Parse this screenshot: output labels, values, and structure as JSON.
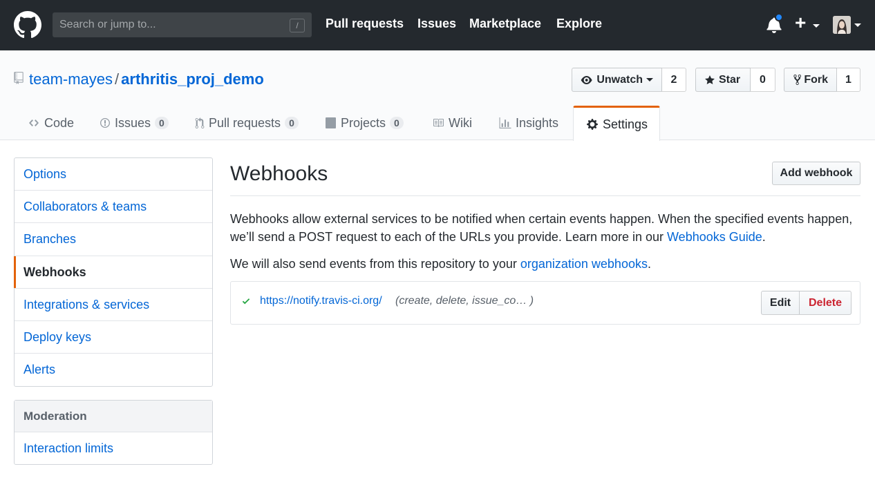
{
  "header": {
    "search_placeholder": "Search or jump to...",
    "search_shortcut": "/",
    "nav": [
      "Pull requests",
      "Issues",
      "Marketplace",
      "Explore"
    ],
    "plus_label": "+"
  },
  "repo": {
    "owner": "team-mayes",
    "separator": "/",
    "name": "arthritis_proj_demo",
    "unwatch_label": "Unwatch",
    "watch_count": "2",
    "star_label": "Star",
    "star_count": "0",
    "fork_label": "Fork",
    "fork_count": "1"
  },
  "tabs": [
    {
      "label": "Code",
      "icon": "code-icon"
    },
    {
      "label": "Issues",
      "icon": "issue-icon",
      "count": "0"
    },
    {
      "label": "Pull requests",
      "icon": "pull-request-icon",
      "count": "0"
    },
    {
      "label": "Projects",
      "icon": "project-icon",
      "count": "0"
    },
    {
      "label": "Wiki",
      "icon": "book-icon"
    },
    {
      "label": "Insights",
      "icon": "graph-icon"
    },
    {
      "label": "Settings",
      "icon": "gear-icon",
      "selected": true
    }
  ],
  "sidebar": {
    "items": [
      "Options",
      "Collaborators & teams",
      "Branches",
      "Webhooks",
      "Integrations & services",
      "Deploy keys",
      "Alerts"
    ],
    "selected": "Webhooks",
    "moderation_heading": "Moderation",
    "moderation_items": [
      "Interaction limits"
    ]
  },
  "main": {
    "title": "Webhooks",
    "add_button": "Add webhook",
    "desc1_text": "Webhooks allow external services to be notified when certain events happen. When the specified events happen, we’ll send a POST request to each of the URLs you provide. Learn more in our ",
    "desc1_link": "Webhooks Guide",
    "desc1_end": ".",
    "desc2_text": "We will also send events from this repository to your ",
    "desc2_link": "organization webhooks",
    "desc2_end": ".",
    "hook": {
      "url": "https://notify.travis-ci.org/",
      "events": "(create, delete, issue_co… )",
      "status_icon": "check-icon",
      "edit_label": "Edit",
      "delete_label": "Delete"
    }
  },
  "colors": {
    "header_bg": "#24292e",
    "link": "#0366d6",
    "accent": "#e36209",
    "success": "#28a745",
    "danger": "#cb2431",
    "notification": "#2188ff"
  }
}
